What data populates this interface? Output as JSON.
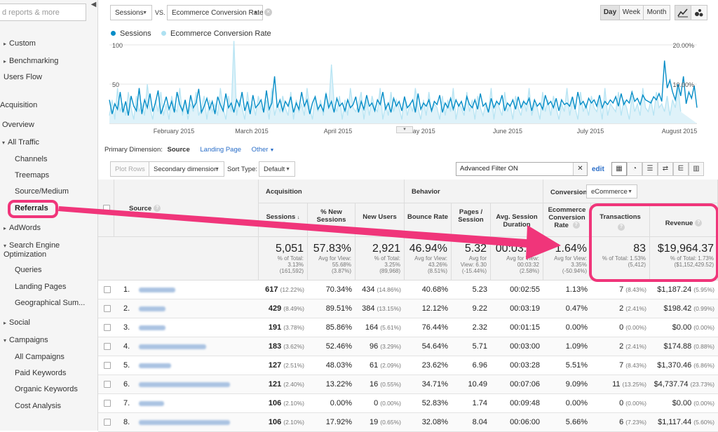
{
  "sidebar": {
    "search_placeholder": "d reports & more",
    "collapse_glyph": "◀",
    "items": [
      {
        "label": "Custom",
        "arrow": "▸"
      },
      {
        "label": "Benchmarking",
        "arrow": "▸"
      },
      {
        "label": "Users Flow"
      },
      {
        "label": "Acquisition"
      },
      {
        "label": "Overview"
      },
      {
        "label": "All Traffic",
        "arrow": "▾"
      },
      {
        "label": "Channels"
      },
      {
        "label": "Treemaps"
      },
      {
        "label": "Source/Medium"
      },
      {
        "label": "Referrals"
      },
      {
        "label": "AdWords",
        "arrow": "▸"
      },
      {
        "label": "Search Engine Optimization",
        "arrow": "▾"
      },
      {
        "label": "Queries"
      },
      {
        "label": "Landing Pages"
      },
      {
        "label": "Geographical Sum..."
      },
      {
        "label": "Social",
        "arrow": "▸"
      },
      {
        "label": "Campaigns",
        "arrow": "▾"
      },
      {
        "label": "All Campaigns"
      },
      {
        "label": "Paid Keywords"
      },
      {
        "label": "Organic Keywords"
      },
      {
        "label": "Cost Analysis"
      }
    ]
  },
  "controls": {
    "metric1": "Sessions",
    "vs": "VS.",
    "metric2": "Ecommerce Conversion Rate",
    "remove_glyph": "✕",
    "period_buttons": [
      "Day",
      "Week",
      "Month"
    ],
    "active_period": "Day"
  },
  "legend": {
    "series1": "Sessions",
    "series2": "Ecommerce Conversion Rate",
    "color1": "#058dc7",
    "color2": "#aee1f2"
  },
  "chart_data": {
    "type": "line",
    "x_labels": [
      "February 2015",
      "March 2015",
      "April 2015",
      "May 2015",
      "June 2015",
      "July 2015",
      "August 2015"
    ],
    "y_left_ticks": [
      "100",
      "50"
    ],
    "y_right_ticks": [
      "20.00%",
      "10.00%"
    ],
    "y_left_range": [
      0,
      100
    ],
    "y_right_range": [
      0,
      20
    ],
    "series": [
      {
        "name": "Sessions",
        "values": [
          30,
          12,
          25,
          18,
          40,
          14,
          28,
          10,
          35,
          22,
          16,
          45,
          12,
          30,
          20,
          38,
          15,
          26,
          42,
          12,
          22,
          34,
          18,
          28,
          14,
          40,
          24,
          16,
          30,
          12,
          36,
          20,
          26,
          44,
          14,
          22,
          32,
          18,
          28,
          12,
          34,
          24,
          16,
          38,
          20,
          26,
          14,
          30,
          22,
          40,
          16,
          28,
          12,
          36,
          20,
          24,
          30,
          14,
          42,
          18,
          26,
          60,
          20,
          30,
          16,
          28,
          22,
          34,
          14,
          26,
          18,
          40,
          22,
          30,
          12,
          26,
          34,
          18,
          24,
          16,
          38,
          20,
          28,
          14,
          32,
          22,
          26,
          16,
          30,
          20,
          24,
          34,
          14,
          28,
          18,
          36,
          22,
          26,
          16,
          30,
          24,
          40,
          18,
          26,
          14,
          32,
          22,
          28,
          16,
          34,
          20,
          24,
          30,
          14,
          38,
          18,
          26,
          22,
          30,
          16,
          28,
          24,
          36,
          14,
          26,
          20,
          32,
          18,
          30,
          22,
          28,
          16,
          34,
          24,
          20,
          30,
          18,
          38,
          22,
          26,
          14,
          32,
          20,
          28,
          24,
          36,
          16,
          26,
          22,
          30,
          18,
          34,
          20,
          28,
          24,
          32,
          16,
          30,
          22,
          26,
          18,
          36,
          24,
          28,
          20,
          32,
          16,
          30,
          24,
          26,
          22,
          34,
          18,
          40,
          24,
          28,
          20,
          32,
          26,
          30,
          22,
          36,
          20,
          28,
          24,
          30,
          26,
          34,
          22,
          38,
          24,
          30,
          26,
          40,
          28,
          32,
          24,
          36,
          30,
          28,
          26,
          34,
          30,
          38,
          28,
          80,
          45,
          55,
          40,
          30,
          50,
          35,
          60,
          25,
          40,
          32,
          48,
          20
        ]
      },
      {
        "name": "Ecommerce Conversion Rate",
        "values": [
          2,
          6,
          1,
          9,
          3,
          5,
          2,
          8,
          4,
          1,
          7,
          3,
          5,
          2,
          10,
          4,
          1,
          6,
          3,
          8,
          2,
          5,
          1,
          7,
          4,
          3,
          9,
          2,
          6,
          1,
          5,
          3,
          8,
          2,
          4,
          7,
          1,
          6,
          3,
          5,
          2,
          9,
          4,
          1,
          7,
          3,
          21,
          2,
          6,
          4,
          1,
          8,
          3,
          5,
          2,
          7,
          4,
          3,
          6,
          1,
          9,
          2,
          5,
          3,
          7,
          4,
          2,
          8,
          1,
          6,
          3,
          5,
          2,
          9,
          4,
          1,
          7,
          3,
          6,
          2,
          8,
          4,
          15,
          5,
          3,
          7,
          1,
          6,
          2,
          9,
          4,
          3,
          5,
          8,
          1,
          6,
          2,
          7,
          4,
          3,
          9,
          1,
          5,
          2,
          8,
          3,
          6,
          4,
          1,
          7,
          2,
          5,
          3,
          9,
          4,
          1,
          6,
          2,
          8,
          3,
          5,
          4,
          1,
          7,
          2,
          6,
          3,
          9,
          1,
          5,
          4,
          2,
          8,
          3,
          6,
          1,
          7,
          4,
          2,
          5,
          3,
          9,
          1,
          6,
          4,
          2,
          8,
          3,
          5,
          1,
          7,
          4,
          2,
          6,
          3,
          9,
          2,
          5,
          4,
          1,
          8,
          3,
          6,
          2,
          7,
          4,
          1,
          5,
          3,
          9,
          2,
          6,
          4,
          1,
          8,
          3,
          5,
          2,
          7,
          4,
          3,
          6,
          1,
          9,
          2,
          5,
          4,
          3,
          8,
          2,
          6,
          4,
          1,
          7,
          3,
          5,
          2,
          9,
          4,
          3,
          6,
          2,
          8,
          4,
          5,
          3,
          7,
          2,
          6,
          4,
          9,
          3
        ]
      }
    ]
  },
  "toolbar": {
    "primary_label": "Primary Dimension:",
    "primary_active": "Source",
    "primary_options": [
      "Landing Page",
      "Other"
    ],
    "plot_rows": "Plot Rows",
    "secondary_dimension": "Secondary dimension",
    "sort_type_label": "Sort Type:",
    "sort_value": "Default",
    "filter_value": "Advanced Filter ON",
    "filter_clear": "✕",
    "edit": "edit",
    "view_icons": [
      "▦",
      "◔",
      "☰",
      "⇄",
      "⋿",
      "▥"
    ]
  },
  "table": {
    "groups": {
      "acquisition": "Acquisition",
      "behavior": "Behavior",
      "conversions": "Conversions",
      "conversions_select": "eCommerce"
    },
    "headers": {
      "source": "Source",
      "sessions": "Sessions",
      "new_sessions": "% New Sessions",
      "new_users": "New Users",
      "bounce": "Bounce Rate",
      "pages": "Pages / Session",
      "duration": "Avg. Session Duration",
      "conv_rate": "Ecommerce Conversion Rate",
      "transactions": "Transactions",
      "revenue": "Revenue"
    },
    "totals": {
      "sessions": {
        "main": "5,051",
        "sub1": "% of Total:",
        "sub2": "3.13%",
        "sub3": "(161,592)"
      },
      "new_sessions": {
        "main": "57.83%",
        "sub1": "Avg for View:",
        "sub2": "55.68%",
        "sub3": "(3.87%)"
      },
      "new_users": {
        "main": "2,921",
        "sub1": "% of Total:",
        "sub2": "3.25%",
        "sub3": "(89,968)"
      },
      "bounce": {
        "main": "46.94%",
        "sub1": "Avg for View:",
        "sub2": "43.26%",
        "sub3": "(8.51%)"
      },
      "pages": {
        "main": "5.32",
        "sub1": "Avg for",
        "sub2": "View: 6.30",
        "sub3": "(-15.44%)"
      },
      "duration": {
        "main": "00:03:37",
        "sub1": "Avg for View:",
        "sub2": "00:03:32",
        "sub3": "(2.58%)"
      },
      "conv_rate": {
        "main": "1.64%",
        "sub1": "Avg for View:",
        "sub2": "3.35%",
        "sub3": "(-50.94%)"
      },
      "transactions": {
        "main": "83",
        "sub1": "% of Total: 1.53%",
        "sub2": "(5,412)"
      },
      "revenue": {
        "main": "$19,964.37",
        "sub1": "% of Total: 1.73%",
        "sub2": "($1,152,429.52)"
      }
    },
    "rows": [
      {
        "rank": "1.",
        "sessions": "617",
        "sessions_pct": "(12.22%)",
        "new_sessions": "70.34%",
        "new_users": "434",
        "new_users_pct": "(14.86%)",
        "bounce": "40.68%",
        "pages": "5.23",
        "duration": "00:02:55",
        "conv_rate": "1.13%",
        "transactions": "7",
        "transactions_pct": "(8.43%)",
        "revenue": "$1,187.24",
        "revenue_pct": "(5.95%)",
        "blur_w": 52
      },
      {
        "rank": "2.",
        "sessions": "429",
        "sessions_pct": "(8.49%)",
        "new_sessions": "89.51%",
        "new_users": "384",
        "new_users_pct": "(13.15%)",
        "bounce": "12.12%",
        "pages": "9.22",
        "duration": "00:03:19",
        "conv_rate": "0.47%",
        "transactions": "2",
        "transactions_pct": "(2.41%)",
        "revenue": "$198.42",
        "revenue_pct": "(0.99%)",
        "blur_w": 38
      },
      {
        "rank": "3.",
        "sessions": "191",
        "sessions_pct": "(3.78%)",
        "new_sessions": "85.86%",
        "new_users": "164",
        "new_users_pct": "(5.61%)",
        "bounce": "76.44%",
        "pages": "2.32",
        "duration": "00:01:15",
        "conv_rate": "0.00%",
        "transactions": "0",
        "transactions_pct": "(0.00%)",
        "revenue": "$0.00",
        "revenue_pct": "(0.00%)",
        "blur_w": 38
      },
      {
        "rank": "4.",
        "sessions": "183",
        "sessions_pct": "(3.62%)",
        "new_sessions": "52.46%",
        "new_users": "96",
        "new_users_pct": "(3.29%)",
        "bounce": "54.64%",
        "pages": "5.71",
        "duration": "00:03:00",
        "conv_rate": "1.09%",
        "transactions": "2",
        "transactions_pct": "(2.41%)",
        "revenue": "$174.88",
        "revenue_pct": "(0.88%)",
        "blur_w": 96
      },
      {
        "rank": "5.",
        "sessions": "127",
        "sessions_pct": "(2.51%)",
        "new_sessions": "48.03%",
        "new_users": "61",
        "new_users_pct": "(2.09%)",
        "bounce": "23.62%",
        "pages": "6.96",
        "duration": "00:03:28",
        "conv_rate": "5.51%",
        "transactions": "7",
        "transactions_pct": "(8.43%)",
        "revenue": "$1,370.46",
        "revenue_pct": "(6.86%)",
        "blur_w": 46
      },
      {
        "rank": "6.",
        "sessions": "121",
        "sessions_pct": "(2.40%)",
        "new_sessions": "13.22%",
        "new_users": "16",
        "new_users_pct": "(0.55%)",
        "bounce": "34.71%",
        "pages": "10.49",
        "duration": "00:07:06",
        "conv_rate": "9.09%",
        "transactions": "11",
        "transactions_pct": "(13.25%)",
        "revenue": "$4,737.74",
        "revenue_pct": "(23.73%)",
        "blur_w": 130
      },
      {
        "rank": "7.",
        "sessions": "106",
        "sessions_pct": "(2.10%)",
        "new_sessions": "0.00%",
        "new_users": "0",
        "new_users_pct": "(0.00%)",
        "bounce": "52.83%",
        "pages": "1.74",
        "duration": "00:09:48",
        "conv_rate": "0.00%",
        "transactions": "0",
        "transactions_pct": "(0.00%)",
        "revenue": "$0.00",
        "revenue_pct": "(0.00%)",
        "blur_w": 36
      },
      {
        "rank": "8.",
        "sessions": "106",
        "sessions_pct": "(2.10%)",
        "new_sessions": "17.92%",
        "new_users": "19",
        "new_users_pct": "(0.65%)",
        "bounce": "32.08%",
        "pages": "8.04",
        "duration": "00:06:00",
        "conv_rate": "5.66%",
        "transactions": "6",
        "transactions_pct": "(7.23%)",
        "revenue": "$1,117.44",
        "revenue_pct": "(5.60%)",
        "blur_w": 130
      }
    ]
  },
  "annotation": {
    "color": "#f0357a"
  }
}
